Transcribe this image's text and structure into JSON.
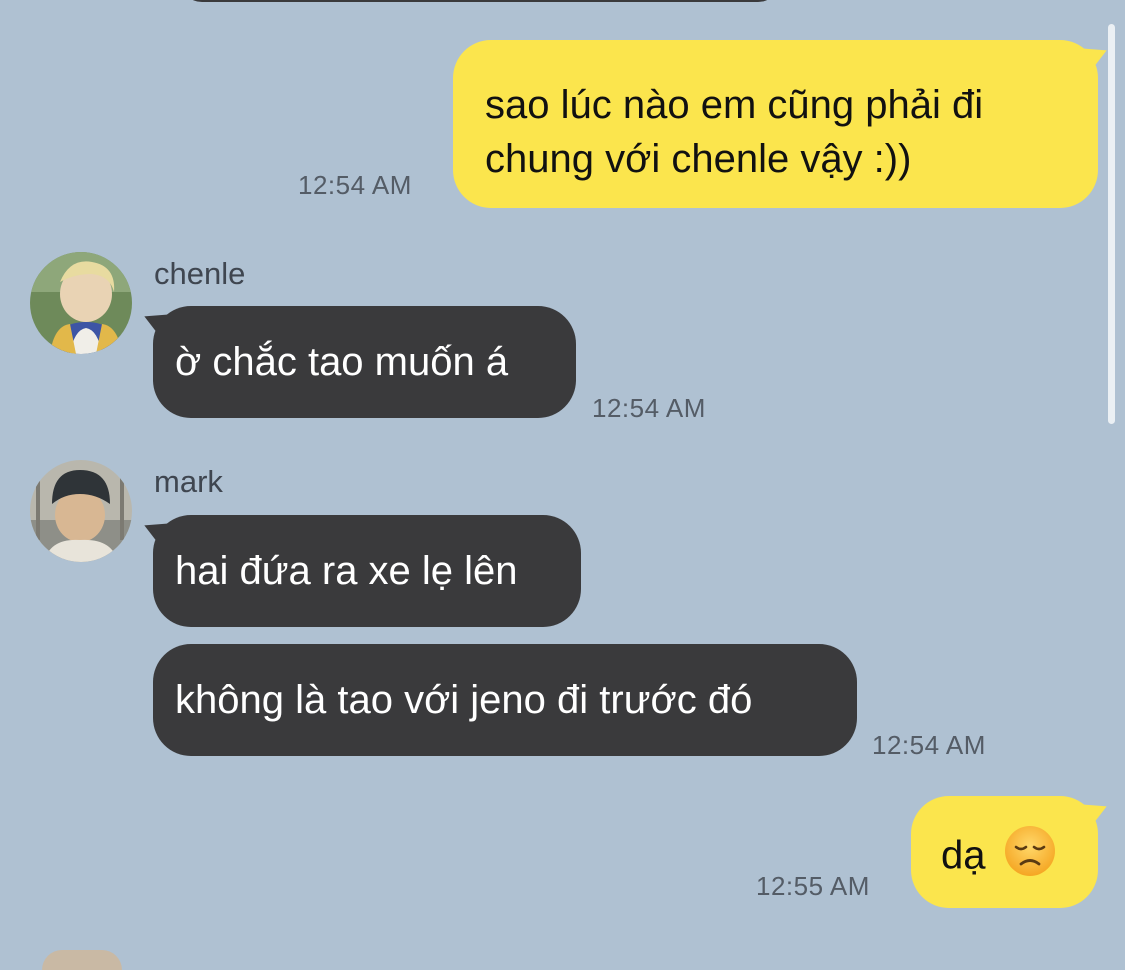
{
  "messages": [
    {
      "id": "m1",
      "direction": "outgoing",
      "lines": [
        "sao lúc nào em cũng phải đi",
        "chung với chenle vậy :))"
      ],
      "time": "12:54 AM"
    },
    {
      "id": "m2",
      "direction": "incoming",
      "sender": "chenle",
      "text": "ờ chắc tao muốn á",
      "time": "12:54 AM"
    },
    {
      "id": "m3",
      "direction": "incoming",
      "sender": "mark",
      "text": "hai đứa ra xe lẹ lên"
    },
    {
      "id": "m4",
      "direction": "incoming",
      "sender": "mark",
      "text": "không là tao với jeno đi trước đó",
      "time": "12:54 AM"
    },
    {
      "id": "m5",
      "direction": "outgoing",
      "text": "dạ",
      "emoji": "disappointed-face",
      "time": "12:55 AM"
    }
  ],
  "colors": {
    "background": "#afc1d2",
    "outgoing_bubble": "#fbe54d",
    "incoming_bubble": "#3a3a3c",
    "timestamp": "#545c66",
    "sender_name": "#3f4650"
  }
}
